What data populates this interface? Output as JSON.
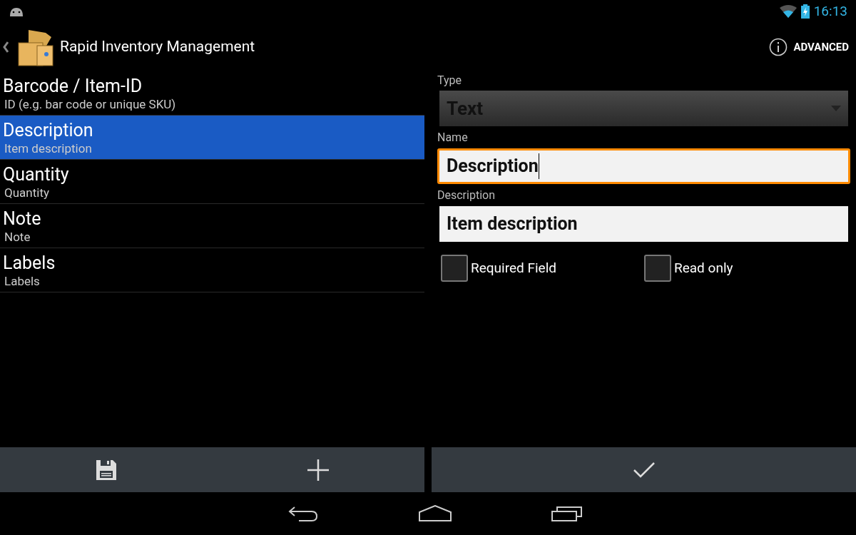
{
  "status_bar": {
    "time": "16:13"
  },
  "action_bar": {
    "title": "Rapid Inventory Management",
    "action": "ADVANCED"
  },
  "fields": [
    {
      "title": "Barcode / Item-ID",
      "subtitle": "ID (e.g. bar code or unique SKU)",
      "selected": false
    },
    {
      "title": "Description",
      "subtitle": "Item description",
      "selected": true
    },
    {
      "title": "Quantity",
      "subtitle": "Quantity",
      "selected": false
    },
    {
      "title": "Note",
      "subtitle": "Note",
      "selected": false
    },
    {
      "title": "Labels",
      "subtitle": "Labels",
      "selected": false
    }
  ],
  "editor": {
    "type": {
      "label": "Type",
      "value": "Text"
    },
    "inputs": [
      {
        "label": "Name",
        "value": "Description",
        "focused": true
      },
      {
        "label": "Description",
        "value": "Item description",
        "focused": false
      }
    ],
    "checkboxes": [
      {
        "label": "Required Field",
        "checked": false
      },
      {
        "label": "Read only",
        "checked": false
      }
    ]
  }
}
